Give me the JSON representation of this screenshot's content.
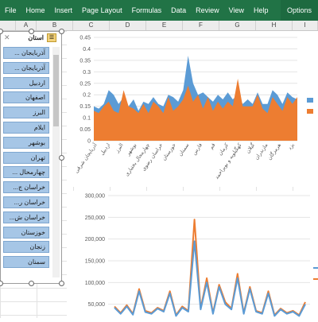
{
  "ribbon": {
    "tabs": [
      "File",
      "Home",
      "Insert",
      "Page Layout",
      "Formulas",
      "Data",
      "Review",
      "View",
      "Help"
    ],
    "options_label": "Options"
  },
  "columns": [
    "A",
    "B",
    "C",
    "D",
    "E",
    "F",
    "G",
    "H",
    "I"
  ],
  "slicer": {
    "title": "استان",
    "items": [
      "آذربایجان ...",
      "آذربایجان ...",
      "اردبیل",
      "اصفهان",
      "البرز",
      "ایلام",
      "بوشهر",
      "تهران",
      "چهارمحال ...",
      "خراسان ج...",
      "خراسان ر...",
      "خراسان ش...",
      "خوزستان",
      "زنجان",
      "سمنان"
    ]
  },
  "chart_data": [
    {
      "type": "area",
      "y_ticks": [
        "0",
        "0.05",
        "0.1",
        "0.15",
        "0.2",
        "0.25",
        "0.3",
        "0.35",
        "0.4",
        "0.45"
      ],
      "ylim": [
        0,
        0.45
      ],
      "x_tick_labels": [
        "آذربایجان شرقی",
        "اردبیل",
        "البرز",
        "بوشهر",
        "چهارمحال بختیاری",
        "خراسان رضوی",
        "خوزستان",
        "سمنان",
        "فارس",
        "قم",
        "کرمان",
        "کهگیلویه و بویراحمد",
        "گیلان",
        "مازندران",
        "هرمزگان",
        "یزد"
      ],
      "series": [
        {
          "color": "#5b9bd5",
          "values": [
            0.15,
            0.14,
            0.16,
            0.22,
            0.2,
            0.16,
            0.19,
            0.15,
            0.18,
            0.13,
            0.17,
            0.16,
            0.19,
            0.16,
            0.15,
            0.2,
            0.19,
            0.17,
            0.22,
            0.37,
            0.25,
            0.2,
            0.21,
            0.19,
            0.17,
            0.2,
            0.18,
            0.21,
            0.18,
            0.2,
            0.16,
            0.18,
            0.16,
            0.21,
            0.16,
            0.16,
            0.22,
            0.2,
            0.16,
            0.21,
            0.19,
            0.18
          ]
        },
        {
          "color": "#ed7d31",
          "values": [
            0.13,
            0.12,
            0.15,
            0.17,
            0.13,
            0.12,
            0.22,
            0.15,
            0.14,
            0.12,
            0.16,
            0.12,
            0.17,
            0.15,
            0.12,
            0.19,
            0.13,
            0.15,
            0.18,
            0.24,
            0.17,
            0.2,
            0.14,
            0.19,
            0.13,
            0.17,
            0.14,
            0.17,
            0.15,
            0.27,
            0.15,
            0.15,
            0.15,
            0.2,
            0.14,
            0.12,
            0.19,
            0.16,
            0.13,
            0.19,
            0.16,
            0.19
          ]
        }
      ]
    },
    {
      "type": "line",
      "y_ticks": [
        "50,000",
        "100,000",
        "150,000",
        "200,000",
        "250,000",
        "300,000"
      ],
      "ylim": [
        0,
        300000
      ],
      "series": [
        {
          "color": "#ed7d31",
          "values": [
            45000,
            30000,
            48000,
            28000,
            85000,
            35000,
            30000,
            42000,
            35000,
            80000,
            25000,
            45000,
            35000,
            245000,
            40000,
            110000,
            30000,
            95000,
            55000,
            40000,
            120000,
            30000,
            90000,
            35000,
            30000,
            80000,
            25000,
            40000,
            30000,
            35000,
            25000,
            55000
          ]
        },
        {
          "color": "#5b9bd5",
          "values": [
            42000,
            28000,
            45000,
            26000,
            80000,
            32000,
            28000,
            40000,
            33000,
            75000,
            23000,
            42000,
            33000,
            195000,
            38000,
            100000,
            28000,
            90000,
            50000,
            38000,
            110000,
            28000,
            85000,
            33000,
            28000,
            75000,
            23000,
            38000,
            28000,
            33000,
            23000,
            50000
          ]
        }
      ]
    }
  ]
}
